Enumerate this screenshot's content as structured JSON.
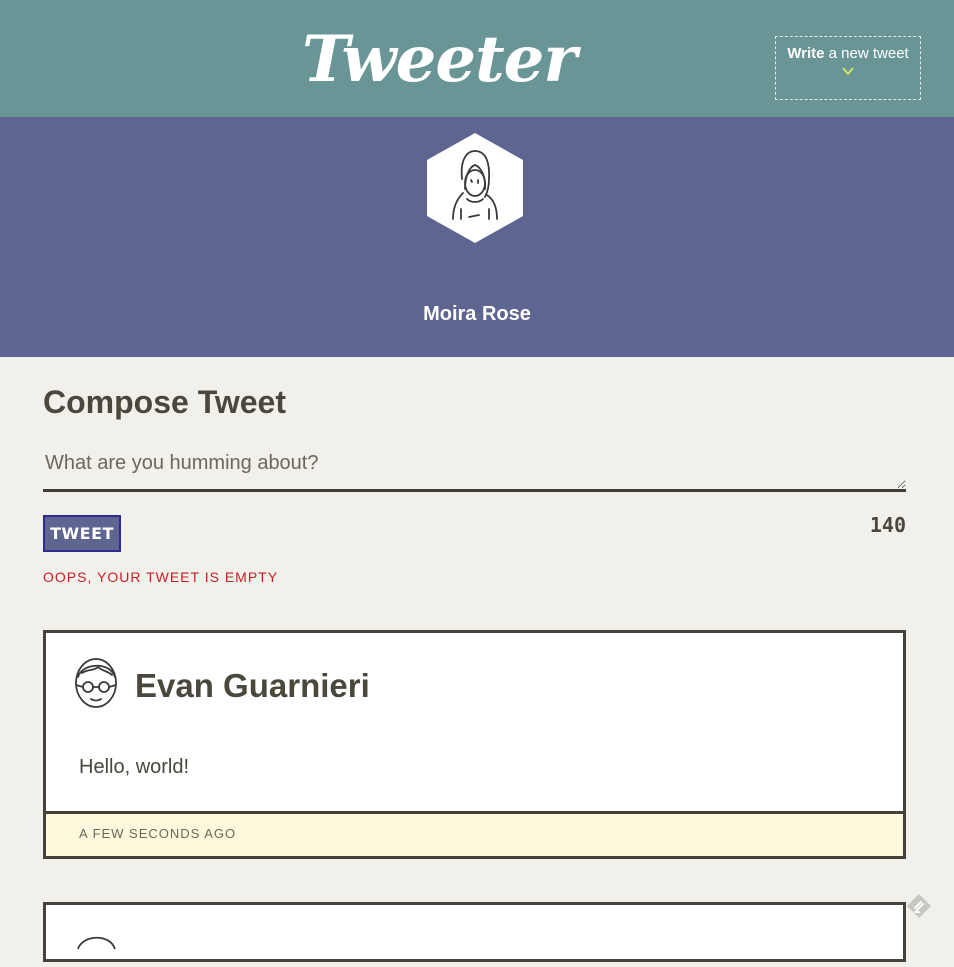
{
  "nav": {
    "brand": "Tweeter",
    "write_bold": "Write",
    "write_rest": " a new tweet"
  },
  "profile": {
    "name": "Moira Rose"
  },
  "compose": {
    "title": "Compose Tweet",
    "placeholder": "What are you humming about?",
    "button_label": "TWEET",
    "counter": "140",
    "error": "OOPS, YOUR TWEET IS EMPTY"
  },
  "tweets": [
    {
      "user": "Evan Guarnieri",
      "text": "Hello, world!",
      "time": "A FEW SECONDS AGO"
    }
  ],
  "colors": {
    "nav_bg": "#6a9596",
    "profile_bg": "#5e6590",
    "page_bg": "#f1f0ea",
    "error": "#c51f26",
    "footer_bg": "#fdf8dc"
  }
}
